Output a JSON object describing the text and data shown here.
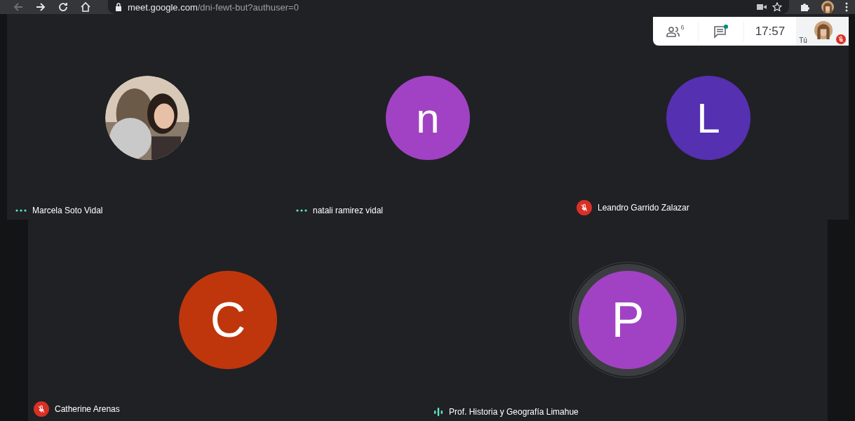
{
  "browser": {
    "back_disabled": true,
    "url_host": "meet.google.com",
    "url_path": "/dni-fewt-but?authuser=0"
  },
  "meeting_bar": {
    "people_count": "6",
    "chat_unread": true,
    "time": "17:57",
    "self_label": "Tú",
    "self_muted": true
  },
  "rows": [
    [
      {
        "name": "Marcela Soto Vidal",
        "audio": {
          "kind": "dots"
        },
        "speaking": false
      },
      {
        "name": "natali ramirez vidal",
        "avatar": {
          "kind": "letter",
          "letter": "n",
          "color": "#a142c4"
        },
        "audio": {
          "kind": "dots"
        },
        "speaking": false
      },
      {
        "name": "Leandro Garrido Zalazar",
        "avatar": {
          "kind": "letter",
          "letter": "L",
          "color": "#5530b0"
        },
        "audio": {
          "kind": "muted"
        },
        "speaking": false
      }
    ],
    [
      {
        "name": "Catherine Arenas",
        "avatar": {
          "kind": "letter",
          "letter": "C",
          "color": "#bf360c"
        },
        "audio": {
          "kind": "muted"
        },
        "speaking": false
      },
      {
        "name": "Prof. Historia y Geografía Limahue",
        "avatar": {
          "kind": "letter",
          "letter": "P",
          "color": "#a142c4"
        },
        "audio": {
          "kind": "bars"
        },
        "speaking": true
      }
    ]
  ]
}
